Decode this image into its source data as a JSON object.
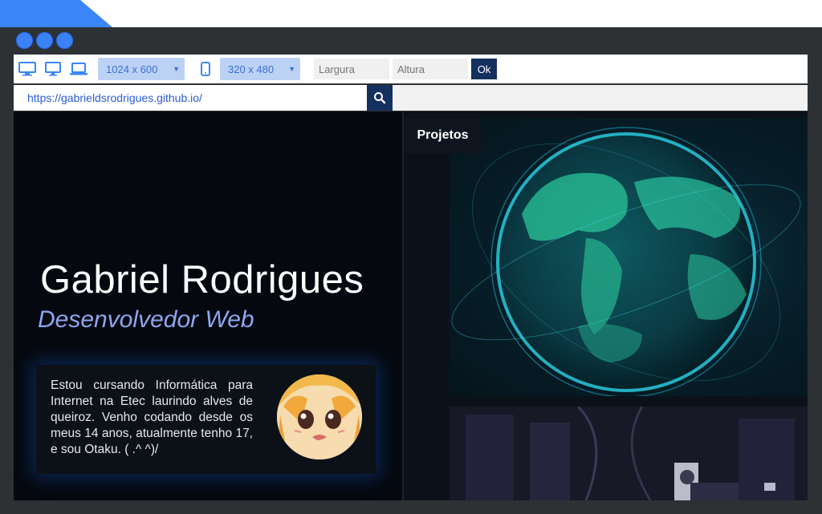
{
  "toolbar": {
    "resolution_large": "1024 x 600",
    "resolution_small": "320 x 480",
    "width_placeholder": "Largura",
    "height_placeholder": "Altura",
    "ok_label": "Ok"
  },
  "url": {
    "value": "https://gabrieldsrodrigues.github.io/"
  },
  "page": {
    "name": "Gabriel Rodrigues",
    "role": "Desenvolvedor Web",
    "bio": "Estou cursando Informática para Internet na Etec laurindo alves de queiroz. Venho codando desde os meus 14 anos, atualmente tenho 17, e sou Otaku. ( .^ ^)/",
    "projects_label": "Projetos"
  },
  "colors": {
    "accent": "#3a86f8",
    "dark_button": "#14305e",
    "role_text": "#8fa6f0"
  }
}
